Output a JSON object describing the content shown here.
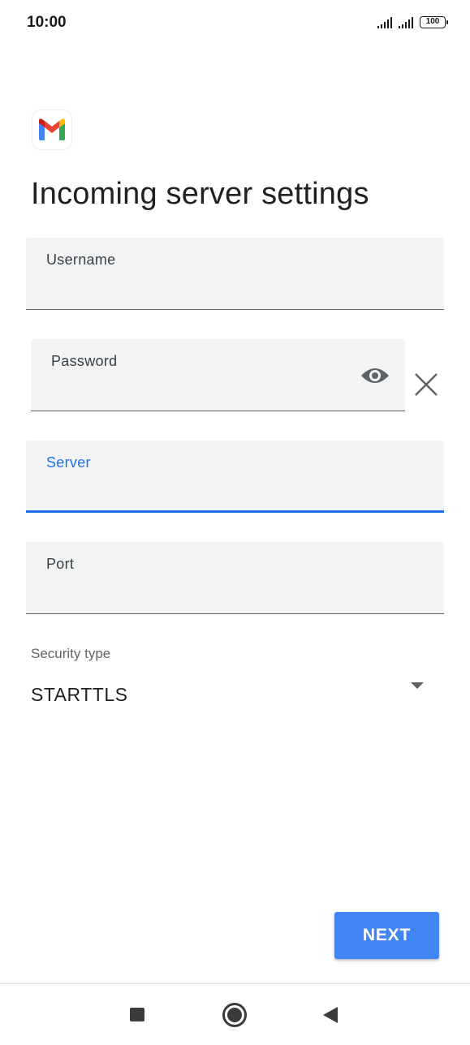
{
  "status_bar": {
    "time": "10:00",
    "battery_level": "100",
    "icons": [
      "signal-icon",
      "signal-icon",
      "battery-icon"
    ]
  },
  "app": {
    "logo_icon": "gmail-logo-icon"
  },
  "page": {
    "title": "Incoming server settings"
  },
  "form": {
    "username": {
      "label": "Username",
      "value": ""
    },
    "password": {
      "label": "Password",
      "value": "",
      "toggle_icon": "eye-icon",
      "clear_icon": "close-icon"
    },
    "server": {
      "label": "Server",
      "value": "",
      "focused": true
    },
    "port": {
      "label": "Port",
      "value": ""
    },
    "security_type": {
      "label": "Security type",
      "value": "STARTTLS"
    }
  },
  "actions": {
    "next_label": "NEXT"
  },
  "colors": {
    "accent": "#1a73e8",
    "button": "#4285f4",
    "field_bg": "#f1f3f4"
  },
  "nav_bar": {
    "icons": [
      "recents-square-icon",
      "home-circle-icon",
      "back-triangle-icon"
    ]
  }
}
